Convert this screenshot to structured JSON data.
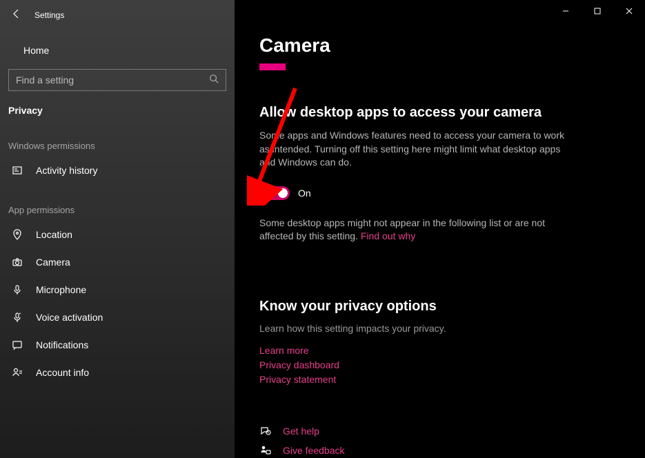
{
  "window": {
    "title": "Settings"
  },
  "sidebar": {
    "home": "Home",
    "search_placeholder": "Find a setting",
    "privacy_label": "Privacy",
    "section_windows_permissions": "Windows permissions",
    "section_app_permissions": "App permissions",
    "items_windows": [
      {
        "icon": "activity-history-icon",
        "label": "Activity history"
      }
    ],
    "items_app": [
      {
        "icon": "location-icon",
        "label": "Location"
      },
      {
        "icon": "camera-icon",
        "label": "Camera"
      },
      {
        "icon": "microphone-icon",
        "label": "Microphone"
      },
      {
        "icon": "voice-activation-icon",
        "label": "Voice activation"
      },
      {
        "icon": "notifications-icon",
        "label": "Notifications"
      },
      {
        "icon": "account-info-icon",
        "label": "Account info"
      }
    ]
  },
  "content": {
    "page_title": "Camera",
    "allow_heading": "Allow desktop apps to access your camera",
    "allow_body": "Some apps and Windows features need to access your camera to work as intended. Turning off this setting here might limit what desktop apps and Windows can do.",
    "toggle_state": "On",
    "note_text": "Some desktop apps might not appear in the following list or are not affected by this setting. ",
    "note_link": "Find out why",
    "know_heading": "Know your privacy options",
    "know_subtitle": "Learn how this setting impacts your privacy.",
    "links": {
      "learn_more": "Learn more",
      "privacy_dashboard": "Privacy dashboard",
      "privacy_statement": "Privacy statement"
    },
    "get_help": "Get help",
    "give_feedback": "Give feedback"
  }
}
